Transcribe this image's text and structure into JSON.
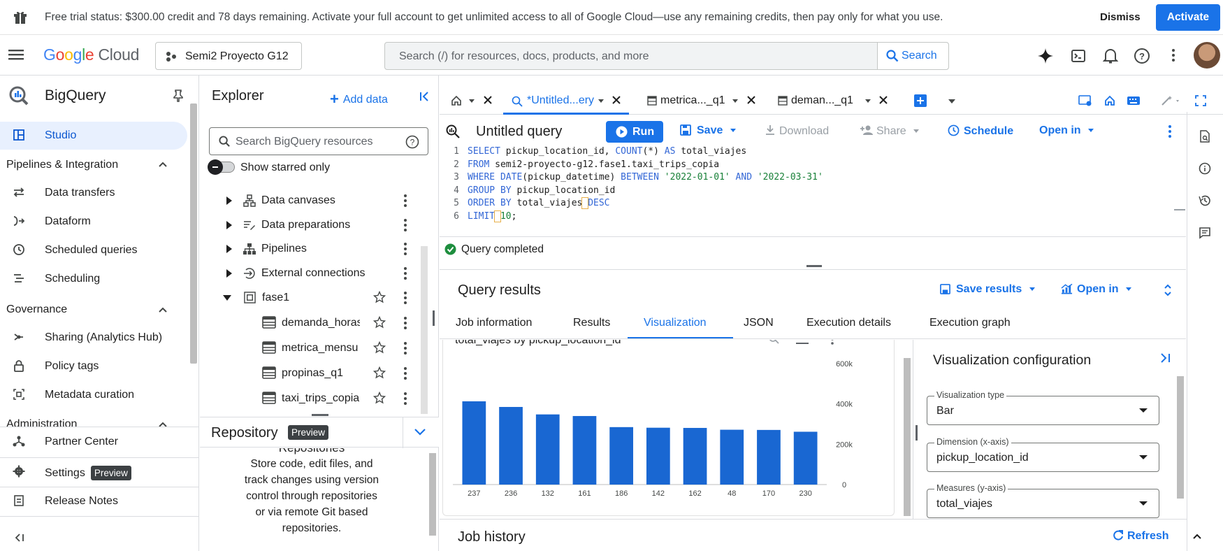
{
  "banner": {
    "text": "Free trial status: $300.00 credit and 78 days remaining. Activate your full account to get unlimited access to all of Google Cloud—use any remaining credits, then pay only for what you use.",
    "dismiss": "Dismiss",
    "activate": "Activate"
  },
  "header": {
    "logo_google": [
      "G",
      "o",
      "o",
      "g",
      "l",
      "e"
    ],
    "logo_cloud": "Cloud",
    "project": "Semi2 Proyecto G12",
    "search_placeholder": "Search (/) for resources, docs, products, and more",
    "search_button": "Search"
  },
  "leftnav": {
    "title": "BigQuery",
    "studio": "Studio",
    "sections": {
      "pipelines": "Pipelines & Integration",
      "governance": "Governance",
      "administration": "Administration"
    },
    "pipelines_items": [
      "Data transfers",
      "Dataform",
      "Scheduled queries",
      "Scheduling"
    ],
    "governance_items": [
      "Sharing (Analytics Hub)",
      "Policy tags",
      "Metadata curation"
    ],
    "bottom_items": [
      "Partner Center",
      "Settings",
      "Release Notes"
    ],
    "preview_badge": "Preview"
  },
  "explorer": {
    "title": "Explorer",
    "add_data": "Add data",
    "search_placeholder": "Search BigQuery resources",
    "show_starred": "Show starred only",
    "tree": [
      "Data canvases",
      "Data preparations",
      "Pipelines",
      "External connections",
      "fase1"
    ],
    "tables": [
      "demanda_horas",
      "metrica_mensu",
      "propinas_q1",
      "taxi_trips_copia"
    ],
    "repository_title": "Repository",
    "repository_badge": "Preview",
    "repository_heading": "Repositories",
    "repository_text": [
      "Store code, edit files, and",
      "track changes using version",
      "control through repositories",
      "or via remote Git based",
      "repositories."
    ]
  },
  "tabs": {
    "t1": "*Untitled...ery",
    "t2": "metrica..._q1",
    "t3": "deman..._q1"
  },
  "editor": {
    "title": "Untitled query",
    "run": "Run",
    "save": "Save",
    "download": "Download",
    "share": "Share",
    "schedule": "Schedule",
    "open_in": "Open in",
    "status": "Query completed",
    "lines": [
      "SELECT pickup_location_id, COUNT(*) AS total_viajes",
      "FROM semi2-proyecto-g12.fase1.taxi_trips_copia",
      "WHERE DATE(pickup_datetime) BETWEEN '2022-01-01' AND '2022-03-31'",
      "GROUP BY pickup_location_id",
      "ORDER BY total_viajes DESC",
      "LIMIT 10;"
    ]
  },
  "results": {
    "title": "Query results",
    "save_results": "Save results",
    "open_in": "Open in",
    "tabs": [
      "Job information",
      "Results",
      "Visualization",
      "JSON",
      "Execution details",
      "Execution graph"
    ],
    "active_tab": "Visualization",
    "chart_title": "total_viajes by pickup_location_id"
  },
  "viz_config": {
    "title": "Visualization configuration",
    "fields": [
      {
        "label": "Visualization type",
        "value": "Bar"
      },
      {
        "label": "Dimension (x-axis)",
        "value": "pickup_location_id"
      },
      {
        "label": "Measures (y-axis)",
        "value": "total_viajes"
      }
    ]
  },
  "job_history": {
    "title": "Job history",
    "refresh": "Refresh"
  },
  "colors": {
    "accent": "#1a73e8",
    "bar": "#1967d2",
    "selected_nav": "#e8f0fe"
  },
  "chart_data": {
    "type": "bar",
    "categories": [
      "237",
      "236",
      "132",
      "161",
      "186",
      "142",
      "162",
      "48",
      "170",
      "230"
    ],
    "values": [
      413000,
      385000,
      348000,
      340000,
      285000,
      282000,
      281000,
      272000,
      271000,
      262000
    ],
    "title": "total_viajes by pickup_location_id",
    "ylim": [
      0,
      600000
    ],
    "yticks": [
      "0",
      "200k",
      "400k",
      "600k"
    ],
    "ytick_values": [
      0,
      200000,
      400000,
      600000
    ],
    "grid": false,
    "y_axis_position": "right"
  }
}
